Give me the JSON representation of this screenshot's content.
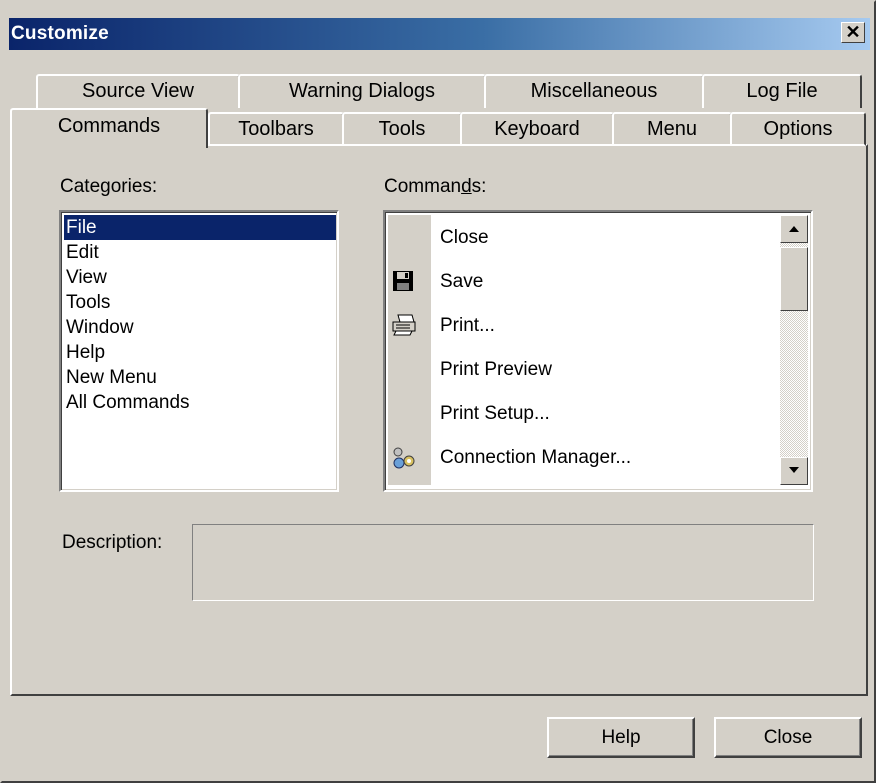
{
  "window": {
    "title": "Customize",
    "close_glyph": "✕"
  },
  "tabs_back": [
    "Source View",
    "Warning Dialogs",
    "Miscellaneous",
    "Log File"
  ],
  "tabs_front": [
    "Commands",
    "Toolbars",
    "Tools",
    "Keyboard",
    "Menu",
    "Options"
  ],
  "active_tab": "Commands",
  "categories": {
    "label_pre": "Cate",
    "label_accel": "g",
    "label_post": "ories:",
    "items": [
      "File",
      "Edit",
      "View",
      "Tools",
      "Window",
      "Help",
      "New Menu",
      "All Commands"
    ],
    "selected": "File"
  },
  "commands": {
    "label_pre": "Comman",
    "label_accel": "d",
    "label_post": "s:",
    "items": [
      {
        "label": "Close",
        "icon": ""
      },
      {
        "label": "Save",
        "icon": "floppy-disk-icon"
      },
      {
        "label": "Print...",
        "icon": "printer-icon"
      },
      {
        "label": "Print Preview",
        "icon": ""
      },
      {
        "label": "Print Setup...",
        "icon": ""
      },
      {
        "label": "Connection Manager...",
        "icon": "connection-manager-icon"
      }
    ]
  },
  "description": {
    "label": "Description:",
    "value": ""
  },
  "buttons": {
    "help": "Help",
    "close": "Close"
  }
}
